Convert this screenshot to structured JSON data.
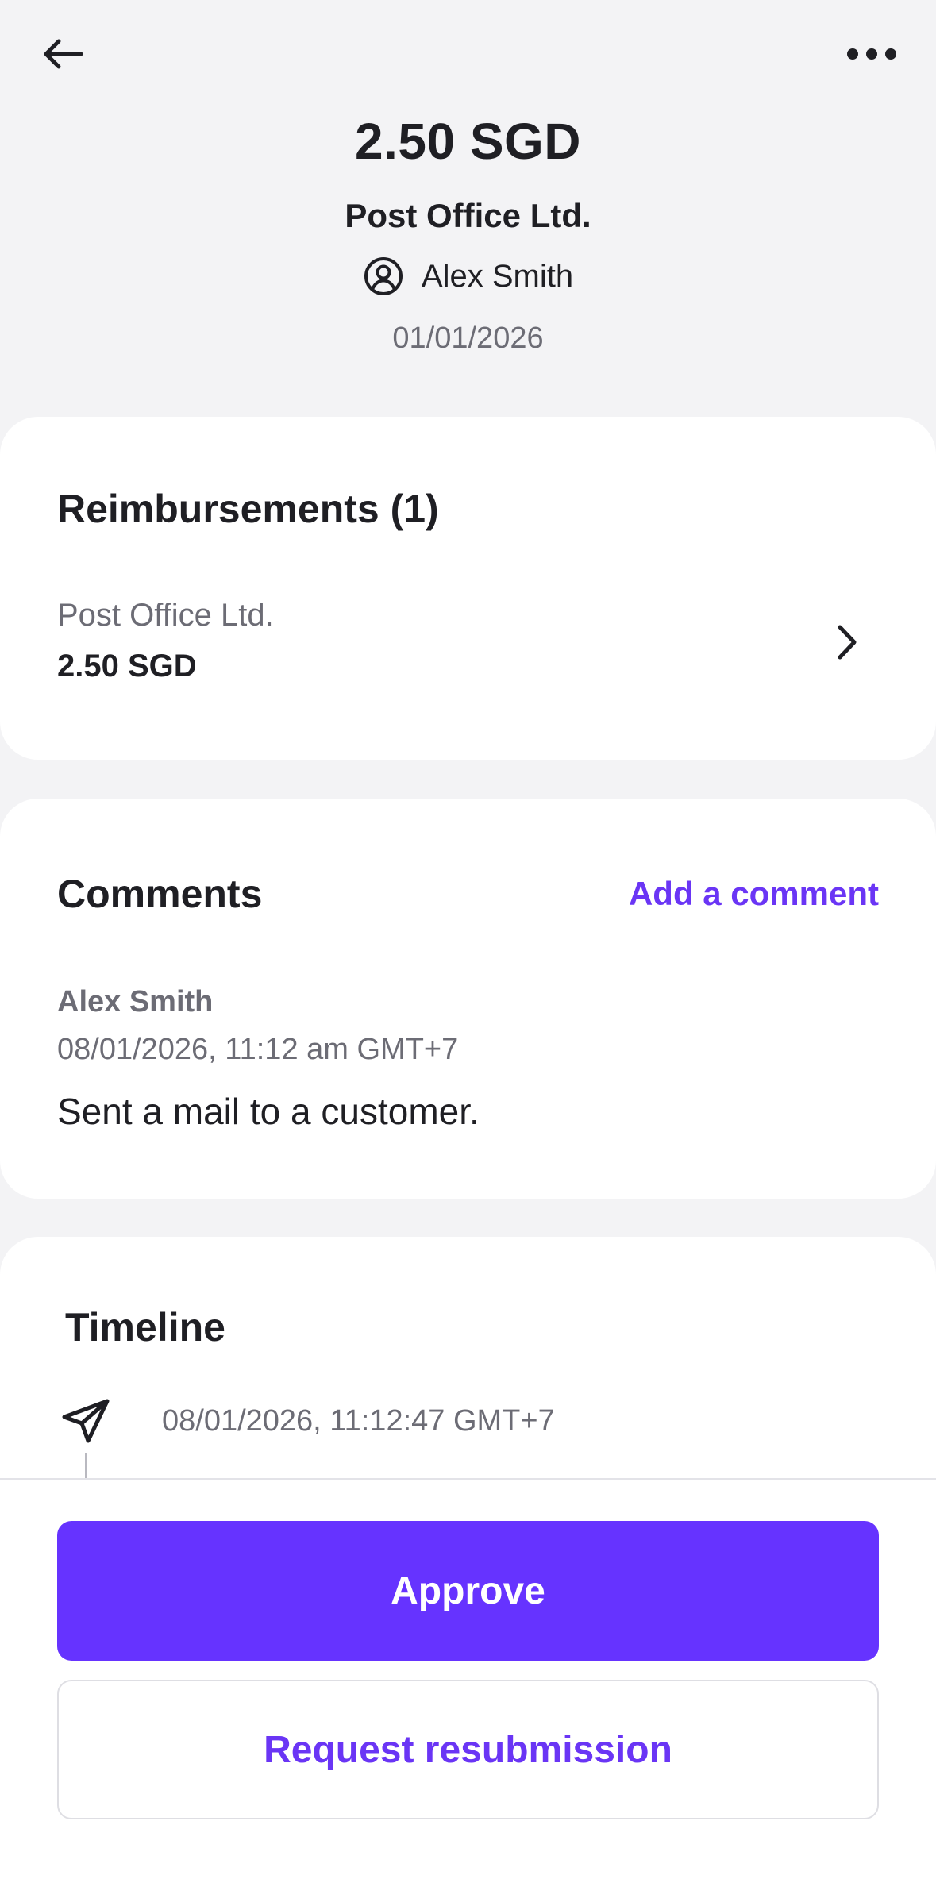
{
  "header": {
    "back_icon": "arrow-left-icon",
    "more_icon": "more-horizontal-icon"
  },
  "summary": {
    "amount": "2.50 SGD",
    "merchant": "Post Office Ltd.",
    "user_icon": "user-circle-icon",
    "user_name": "Alex Smith",
    "date": "01/01/2026"
  },
  "reimbursements": {
    "title": "Reimbursements (1)",
    "items": [
      {
        "merchant": "Post Office Ltd.",
        "amount": "2.50 SGD",
        "chevron_icon": "chevron-right-icon"
      }
    ]
  },
  "comments": {
    "title": "Comments",
    "add_label": "Add a comment",
    "items": [
      {
        "author": "Alex Smith",
        "timestamp": "08/01/2026, 11:12 am GMT+7",
        "text": "Sent a mail to a customer."
      }
    ]
  },
  "timeline": {
    "title": "Timeline",
    "entries": [
      {
        "icon": "send-icon",
        "timestamp": "08/01/2026, 11:12:47 GMT+7"
      }
    ]
  },
  "actions": {
    "approve_label": "Approve",
    "resubmit_label": "Request resubmission"
  },
  "colors": {
    "accent": "#6633ff",
    "link": "#6a35f5",
    "background": "#f3f3f5",
    "text_primary": "#1f1f24",
    "text_secondary": "#6c6c75"
  }
}
